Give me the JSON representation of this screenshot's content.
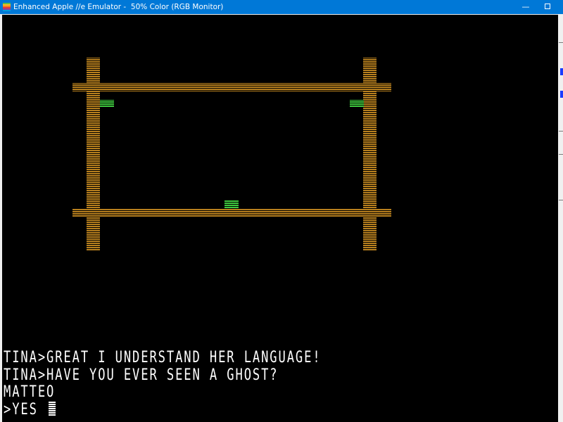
{
  "window": {
    "title": "Enhanced Apple //e Emulator -  50% Color (RGB Monitor)",
    "controls": {
      "minimize": "—",
      "close": "✕"
    }
  },
  "colors": {
    "titlebar": "#0078d7",
    "screen_bg": "#000000",
    "fence": "#b8801e",
    "ghost": "#3ec93e",
    "text": "#ffffff"
  },
  "console": {
    "lines": [
      "TINA>GREAT I UNDERSTAND HER LANGUAGE!",
      "TINA>HAVE YOU EVER SEEN A GHOST?",
      "MATTEO",
      ">YES"
    ]
  }
}
